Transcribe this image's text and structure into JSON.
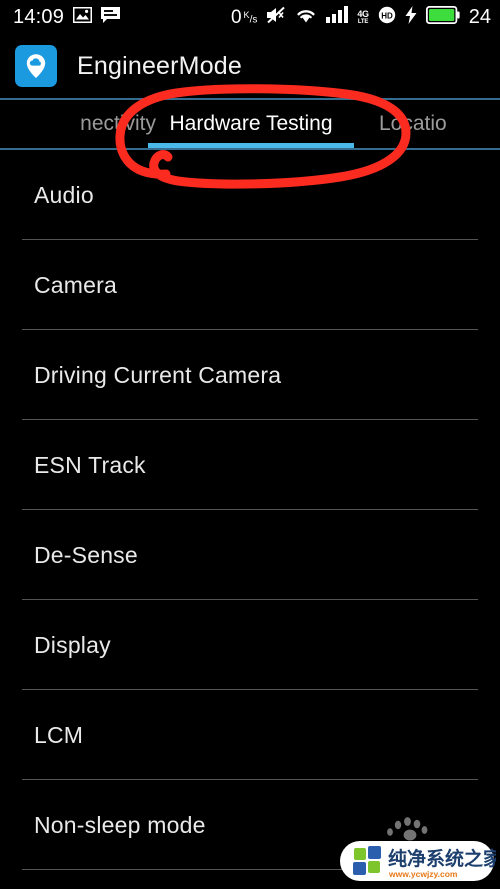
{
  "status_bar": {
    "time": "14:09",
    "left_icons": [
      "image-icon",
      "message-icon"
    ],
    "net_speed_value": "0",
    "net_speed_unit_top": "K",
    "net_speed_unit_bottom": "s",
    "right_icons": [
      "mute-icon",
      "wifi-icon",
      "signal-bars-icon",
      "4g-lte-icon",
      "hd-call-icon",
      "charging-bolt-icon",
      "battery-icon"
    ],
    "network_type_primary": "4G",
    "network_type_secondary": "LTE",
    "hd_label": "HD",
    "battery_percent": "24",
    "battery_color": "#3ddd3d"
  },
  "app_bar": {
    "icon_name": "engineermode-app-icon",
    "icon_bg": "#1b9ae0",
    "title": "EngineerMode"
  },
  "tabs": {
    "accent_color": "#4ab8e8",
    "rule_color": "#3f7fa8",
    "items": [
      {
        "label": "nectivity",
        "full_label": "Connectivity",
        "active": false
      },
      {
        "label": "Hardware Testing",
        "full_label": "Hardware Testing",
        "active": true
      },
      {
        "label": "Locatio",
        "full_label": "Location",
        "active": false
      }
    ]
  },
  "list": {
    "items": [
      {
        "label": "Audio"
      },
      {
        "label": "Camera"
      },
      {
        "label": "Driving Current Camera"
      },
      {
        "label": "ESN Track"
      },
      {
        "label": "De-Sense"
      },
      {
        "label": "Display"
      },
      {
        "label": "LCM"
      },
      {
        "label": "Non-sleep mode"
      }
    ]
  },
  "annotation": {
    "name": "red-circle-highlight",
    "color": "#fb2b20",
    "target": "Hardware Testing"
  },
  "watermark": {
    "site_name": "纯净系统之家",
    "site_url": "www.ycwjzy.com",
    "name_color": "#1c3f6e",
    "url_color": "#e87a18",
    "logo_blue": "#2b5fae",
    "logo_green": "#7ec42b",
    "paw_icon": "paw-print-icon"
  }
}
